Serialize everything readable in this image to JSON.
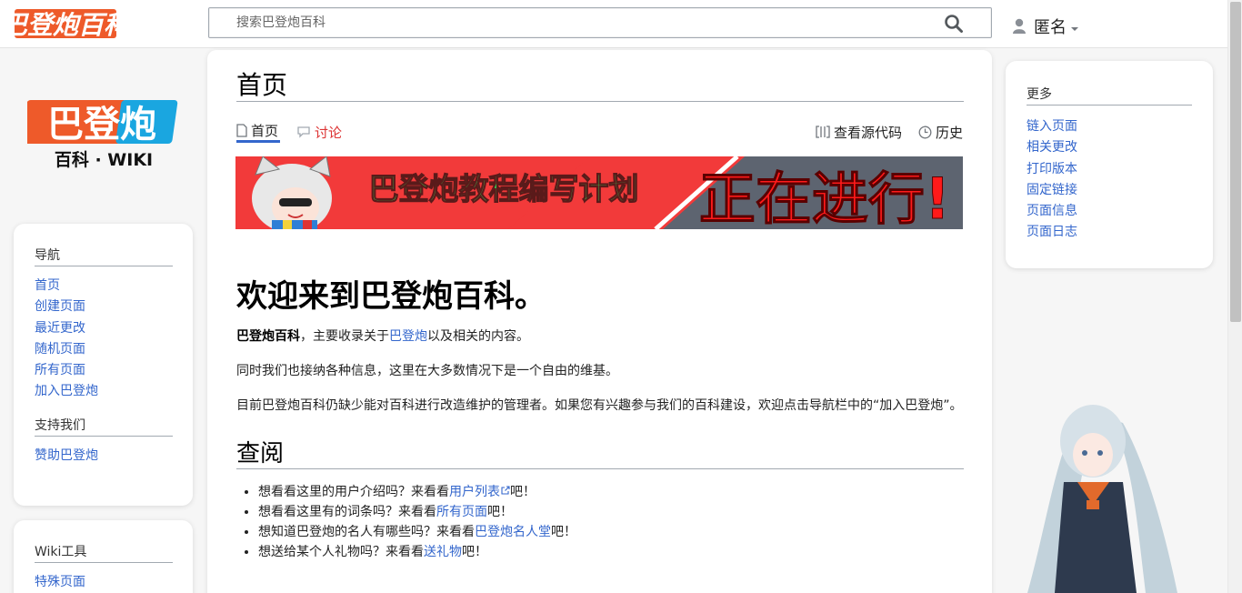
{
  "header": {
    "logo_text": "巴登炮百科",
    "search_placeholder": "搜索巴登炮百科",
    "user_name": "匿名"
  },
  "sidebar": {
    "logo_title": "巴登炮",
    "logo_subtitle": "百科 · WIKI",
    "navigation": {
      "heading": "导航",
      "items": [
        "首页",
        "创建页面",
        "最近更改",
        "随机页面",
        "所有页面",
        "加入巴登炮"
      ]
    },
    "support": {
      "heading": "支持我们",
      "items": [
        "赞助巴登炮"
      ]
    },
    "tools": {
      "heading": "Wiki工具",
      "items": [
        "特殊页面"
      ]
    }
  },
  "right_sidebar": {
    "more": {
      "heading": "更多",
      "items": [
        "链入页面",
        "相关更改",
        "打印版本",
        "固定链接",
        "页面信息",
        "页面日志"
      ]
    }
  },
  "page": {
    "title": "首页",
    "tabs": {
      "page": "首页",
      "discussion": "讨论",
      "view_source": "查看源代码",
      "history": "历史"
    },
    "banner": {
      "left_text": "巴登炮教程编写计划",
      "right_text": "正在进行!"
    },
    "welcome_heading": "欢迎来到巴登炮百科。",
    "intro": {
      "bold": "巴登炮百科",
      "text1": "，主要收录关于",
      "link": "巴登炮",
      "text2": "以及相关的内容。"
    },
    "para2": "同时我们也接纳各种信息，这里在大多数情况下是一个自由的维基。",
    "para3": "目前巴登炮百科仍缺少能对百科进行改造维护的管理者。如果您有兴趣参与我们的百科建设，欢迎点击导航栏中的“加入巴登炮”。",
    "browse_heading": "查阅",
    "browse_items": [
      {
        "prefix": "想看看这里的用户介绍吗？来看看",
        "link": "用户列表",
        "suffix": "吧！"
      },
      {
        "prefix": "想看看这里有的词条吗？来看看",
        "link": "所有页面",
        "suffix": "吧！"
      },
      {
        "prefix": "想知道巴登炮的名人有哪些吗？来看看",
        "link": "巴登炮名人堂",
        "suffix": "吧！"
      },
      {
        "prefix": "想送给某个人礼物吗？来看看",
        "link": "送礼物",
        "suffix": "吧！"
      }
    ]
  },
  "colors": {
    "link": "#3366cc",
    "discussion_link": "#dd3333",
    "logo_orange": "#ee5a2a",
    "logo_blue": "#1aa6e0",
    "banner_red": "#f23a3a",
    "banner_gray": "#5d6470",
    "banner_green": "#33e35b"
  },
  "icons": {
    "search": "search-icon",
    "user": "user-icon",
    "page": "page-icon",
    "discussion": "speech-bubble-icon",
    "view_source": "code-icon",
    "history": "clock-icon",
    "external_link": "external-link-icon"
  }
}
